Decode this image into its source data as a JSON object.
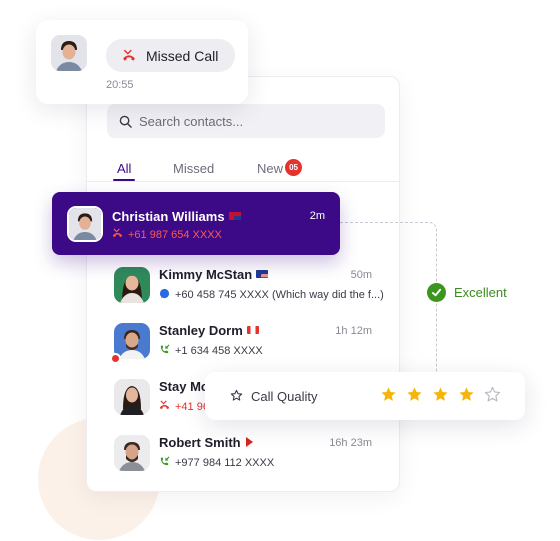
{
  "missed_card": {
    "label": "Missed Call",
    "time": "20:55"
  },
  "search": {
    "placeholder": "Search contacts..."
  },
  "tabs": {
    "all": "All",
    "missed": "Missed",
    "new": "New",
    "new_count": "05"
  },
  "contacts": [
    {
      "name": "Christian Williams",
      "time": "2m",
      "detail": "+61 987 654 XXXX",
      "call": "missed",
      "flag": "AU"
    },
    {
      "name": "Kimmy McStan",
      "time": "50m",
      "detail": "+60 458 745 XXXX (Which way did the f...)",
      "call": "message",
      "flag": "MY"
    },
    {
      "name": "Stanley Dorm",
      "time": "1h 12m",
      "detail": "+1 634 458 XXXX",
      "call": "incoming",
      "flag": "CA"
    },
    {
      "name": "Stay Mc",
      "time": "",
      "detail": "+41 96",
      "call": "missed",
      "flag": ""
    },
    {
      "name": "Robert Smith",
      "time": "16h 23m",
      "detail": "+977 984 112 XXXX",
      "call": "incoming",
      "flag": "NP"
    }
  ],
  "quality": {
    "label": "Call Quality",
    "rating": 4,
    "max": 5,
    "status": "Excellent"
  },
  "colors": {
    "accent": "#3c0a86",
    "missed": "#e5322d",
    "success": "#3c961e",
    "star": "#f5b50a"
  }
}
